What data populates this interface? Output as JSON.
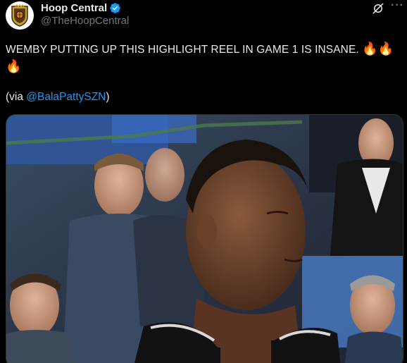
{
  "author": {
    "display_name": "Hoop Central",
    "handle": "@TheHoopCentral",
    "verified": true,
    "avatar_icon": "hoop-central-logo-icon"
  },
  "actions": {
    "grok_icon": "grok-icon",
    "more_icon": "more-options-icon",
    "more_label": "···"
  },
  "tweet": {
    "text": "WEMBY PUTTING UP THIS HIGHLIGHT REEL IN GAME 1 IS INSANE.",
    "emojis": "🔥🔥🔥",
    "via_prefix": "(via ",
    "via_mention": "@BalaPattySZN",
    "via_suffix": ")"
  },
  "media": {
    "type": "video-frame"
  },
  "colors": {
    "background": "#000000",
    "text": "#e7e9ea",
    "secondary": "#71767b",
    "link": "#1d9bf0",
    "verified": "#1d9bf0"
  }
}
